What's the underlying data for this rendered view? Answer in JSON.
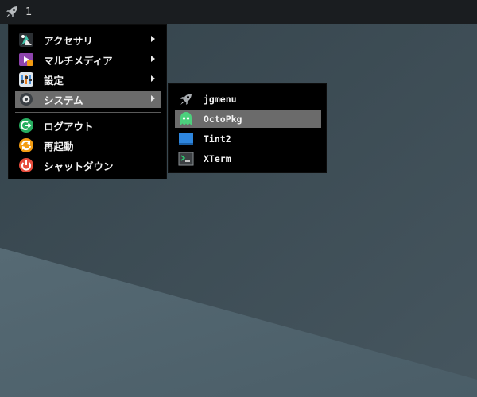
{
  "panel": {
    "launcher_icon": "rocket-icon",
    "workspace": "1"
  },
  "main_menu": {
    "items": [
      {
        "label": "アクセサリ",
        "icon": "accessories-icon",
        "submenu": true
      },
      {
        "label": "マルチメディア",
        "icon": "multimedia-icon",
        "submenu": true
      },
      {
        "label": "設定",
        "icon": "settings-icon",
        "submenu": true
      },
      {
        "label": "システム",
        "icon": "system-icon",
        "submenu": true,
        "active": true
      },
      {
        "label": "ログアウト",
        "icon": "logout-icon",
        "submenu": false
      },
      {
        "label": "再起動",
        "icon": "reboot-icon",
        "submenu": false
      },
      {
        "label": "シャットダウン",
        "icon": "shutdown-icon",
        "submenu": false
      }
    ]
  },
  "system_submenu": {
    "items": [
      {
        "label": "jgmenu",
        "icon": "rocket-icon"
      },
      {
        "label": "OctoPkg",
        "icon": "octopkg-icon",
        "active": true
      },
      {
        "label": "Tint2",
        "icon": "tint2-icon"
      },
      {
        "label": "XTerm",
        "icon": "terminal-icon"
      }
    ]
  },
  "colors": {
    "panel_bg": "#1a1d20",
    "menu_bg": "#000000",
    "highlight": "#6b6b6b",
    "wallpaper_dark": "#3f5059",
    "wallpaper_light": "#586c76"
  }
}
